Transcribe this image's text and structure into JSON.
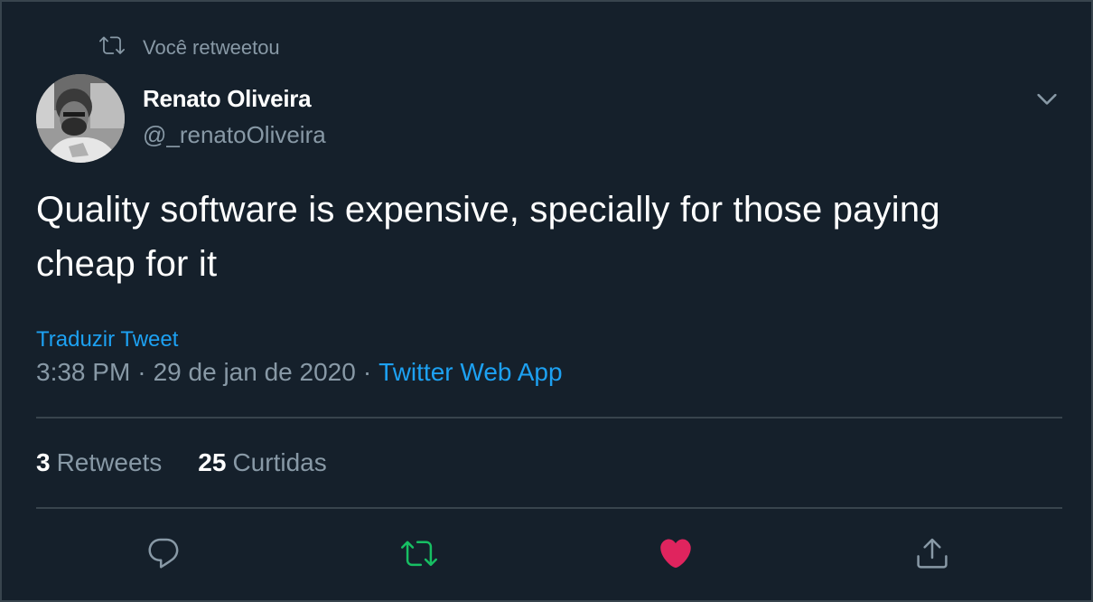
{
  "retweet_context": {
    "label": "Você retweetou",
    "icon": "retweet-icon"
  },
  "author": {
    "name": "Renato Oliveira",
    "handle": "@_renatoOliveira",
    "avatar": "avatar-photo"
  },
  "tweet": {
    "text": "Quality software is expensive, specially for those paying cheap for it",
    "translate_label": "Traduzir Tweet",
    "time": "3:38 PM",
    "date": "29 de jan de 2020",
    "separator": "·",
    "source": "Twitter Web App"
  },
  "stats": {
    "retweets_count": "3",
    "retweets_label": "Retweets",
    "likes_count": "25",
    "likes_label": "Curtidas"
  },
  "actions": {
    "reply_icon": "reply-icon",
    "retweet_icon": "retweet-icon",
    "like_icon": "heart-icon",
    "share_icon": "share-icon"
  },
  "colors": {
    "background": "#15202b",
    "border": "#38444d",
    "primary_text": "#ffffff",
    "secondary_text": "#8899a6",
    "link": "#1da1f2",
    "retweet_active": "#17bf63",
    "like_active": "#e0245e"
  }
}
